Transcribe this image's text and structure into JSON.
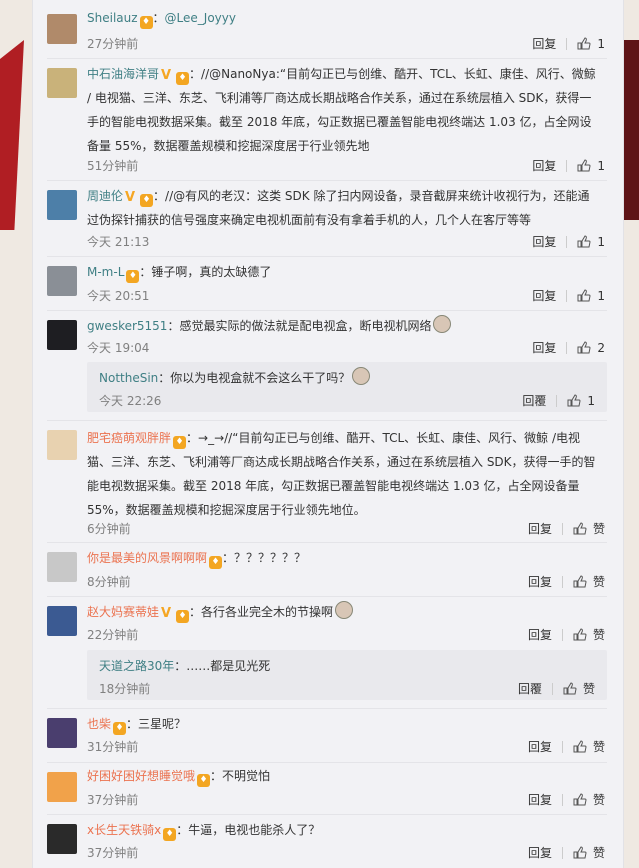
{
  "comments": [
    {
      "user": "Sheilauz",
      "sep": "：",
      "text": "@Lee_Joyyy",
      "time": "27分钟前",
      "reply": "回复",
      "likes": "1"
    },
    {
      "user": "中石油海洋哥",
      "sep": "：",
      "text": "//@NanoNya:“目前勾正已与创维、酷开、TCL、长虹、康佳、风行、微鲸 / 电视猫、三洋、东芝、飞利浦等厂商达成长期战略合作关系，通过在系统层植入 SDK，获得一手的智能电视数据采集。截至 2018 年底，勾正数据已覆盖智能电视终端达 1.03 亿，占全网设备量 55%，数据覆盖规模和挖掘深度居于行业领先地",
      "time": "51分钟前",
      "reply": "回复",
      "likes": "1"
    },
    {
      "user": "周迪伦",
      "sep": "：",
      "text": "//@有风的老汉：这类 SDK 除了扫内网设备，录音截屏来统计收视行为，还能通过伪探针捕获的信号强度来确定电视机面前有没有拿着手机的人，几个人在客厅等等",
      "time": "今天 21:13",
      "reply": "回复",
      "likes": "1"
    },
    {
      "user": "M-m-L",
      "sep": "：",
      "text": "锤子啊，真的太缺德了",
      "time": "今天 20:51",
      "reply": "回复",
      "likes": "1"
    },
    {
      "user": "gwesker5151",
      "sep": "：",
      "text": "感觉最实际的做法就是配电视盒，断电视机网络",
      "time": "今天 19:04",
      "reply": "回复",
      "likes": "2"
    },
    {
      "user": "肥宅癌萌观胖胖",
      "sep": "：",
      "text": "→_→//“目前勾正已与创维、酷开、TCL、长虹、康佳、风行、微鲸 /电视猫、三洋、东芝、飞利浦等厂商达成长期战略合作关系，通过在系统层植入 SDK，获得一手的智能电视数据采集。截至 2018 年底，勾正数据已覆盖智能电视终端达 1.03 亿，占全网设备量 55%，数据覆盖规模和挖掘深度居于行业领先地位。",
      "time": "6分钟前",
      "reply": "回复",
      "likes": "赞"
    },
    {
      "user": "你是最美的风景啊啊啊",
      "sep": "：",
      "text": "？？？？？？",
      "time": "8分钟前",
      "reply": "回复",
      "likes": "赞"
    },
    {
      "user": "赵大妈赛蒂娃",
      "sep": "：",
      "text": "各行各业完全木的节操啊",
      "time": "22分钟前",
      "reply": "回复",
      "likes": "赞"
    },
    {
      "user": "也柴",
      "sep": "：",
      "text": "三星呢？",
      "time": "31分钟前",
      "reply": "回复",
      "likes": "赞"
    },
    {
      "user": "好困好困好想睡觉哦",
      "sep": "：",
      "text": "不明觉怕",
      "time": "37分钟前",
      "reply": "回复",
      "likes": "赞"
    },
    {
      "user": "x长生天铁骑x",
      "sep": "：",
      "text": "牛逼，电视也能杀人了？",
      "time": "37分钟前",
      "reply": "回复",
      "likes": "赞"
    }
  ],
  "subreplies": [
    {
      "user": "NottheSin",
      "sep": "：",
      "text": "你以为电视盒就不会这么干了吗？",
      "time": "今天 22:26",
      "reply": "回覆",
      "likes": "1"
    },
    {
      "user": "天道之路30年",
      "sep": "：",
      "text": "……都是见光死",
      "time": "18分钟前",
      "reply": "回覆",
      "likes": "赞"
    }
  ],
  "colors": {
    "username": "#eb7350",
    "link": "#3f7f84",
    "bg": "#f2f2f5"
  }
}
